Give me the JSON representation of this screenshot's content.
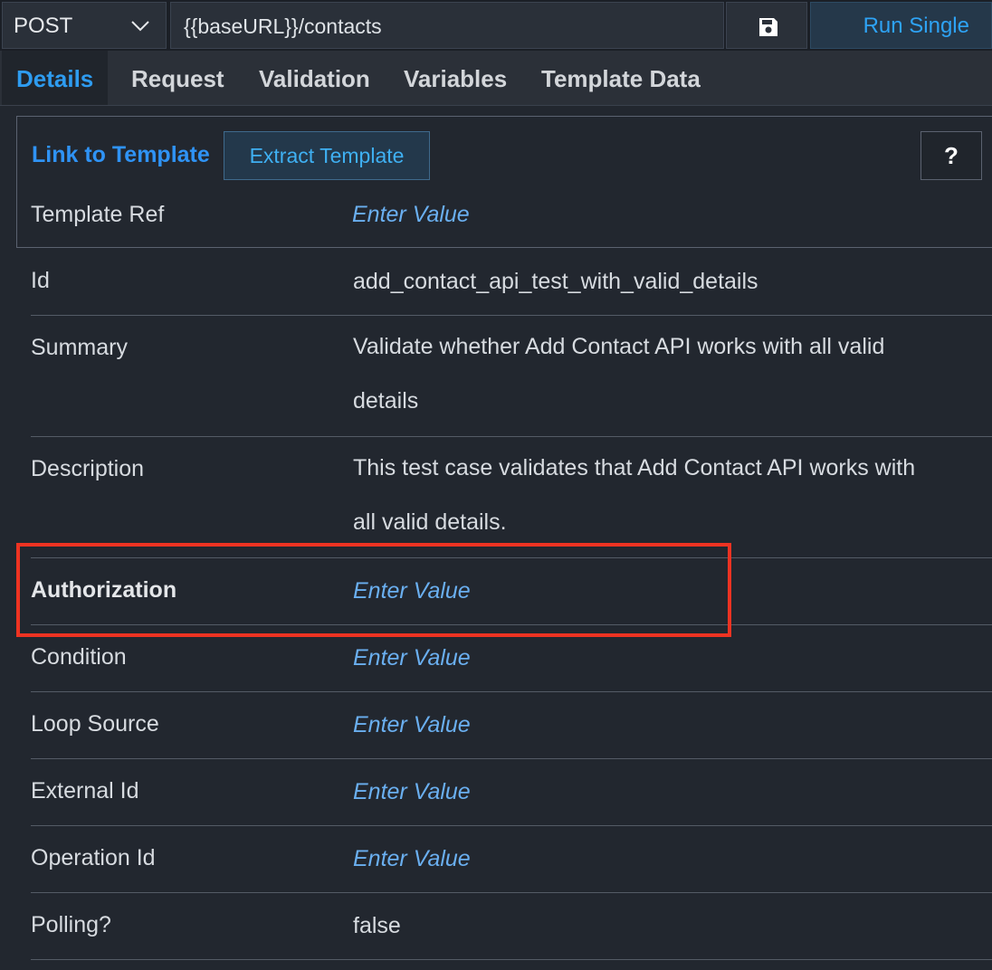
{
  "toolbar": {
    "method": "POST",
    "url": "{{baseURL}}/contacts",
    "run_label": "Run Single"
  },
  "tabs": [
    {
      "label": "Details",
      "active": true
    },
    {
      "label": "Request"
    },
    {
      "label": "Validation"
    },
    {
      "label": "Variables"
    },
    {
      "label": "Template Data"
    }
  ],
  "template": {
    "link_label": "Link to Template",
    "extract_label": "Extract Template",
    "help_label": "?",
    "ref_label": "Template Ref",
    "ref_value": "Enter Value"
  },
  "fields": [
    {
      "label": "Id",
      "value": "add_contact_api_test_with_valid_details"
    },
    {
      "label": "Summary",
      "value": "Validate whether Add Contact API works with all valid details"
    },
    {
      "label": "Description",
      "value": "This test case validates that Add Contact API works with all valid details."
    },
    {
      "label": "Authorization",
      "value": "Enter Value",
      "highlighted": true
    },
    {
      "label": "Condition",
      "value": "Enter Value"
    },
    {
      "label": "Loop Source",
      "value": "Enter Value"
    },
    {
      "label": "External Id",
      "value": "Enter Value"
    },
    {
      "label": "Operation Id",
      "value": "Enter Value"
    },
    {
      "label": "Polling?",
      "value": "false"
    }
  ],
  "colors": {
    "accent": "#2e9cf0",
    "placeholder": "#6aaff0",
    "highlight": "#ee3322"
  }
}
